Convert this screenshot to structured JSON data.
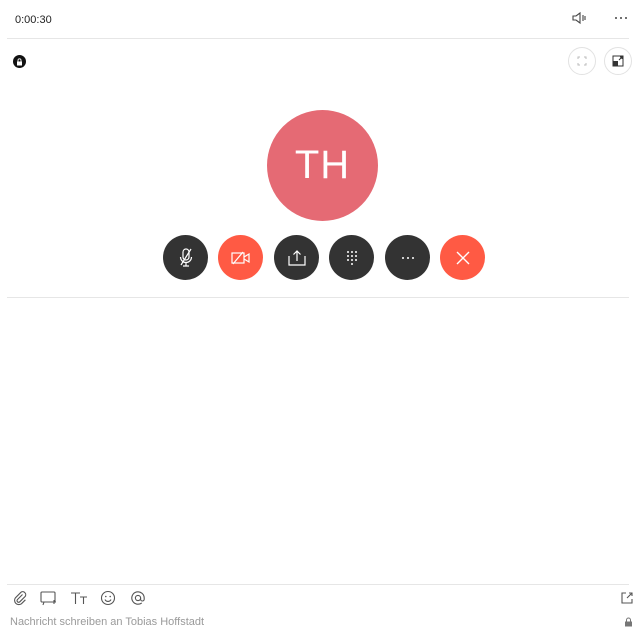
{
  "call": {
    "timer": "0:00:30",
    "avatar_initials": "TH",
    "colors": {
      "avatar": "#e56a74",
      "end_call": "#ff5a44",
      "video_off": "#ff5a44",
      "control_dark": "#333333"
    }
  },
  "header_icons": [
    "speaker-icon",
    "more-icon"
  ],
  "controls": [
    "mic-off-icon",
    "video-off-icon",
    "share-screen-icon",
    "dialpad-icon",
    "more-options-icon",
    "end-call-icon"
  ],
  "composer": {
    "placeholder": "Nachricht schreiben an Tobias Hoffstadt",
    "toolbar": [
      "attach-icon",
      "gif-icon",
      "text-format-icon",
      "emoji-icon",
      "mention-icon"
    ]
  }
}
